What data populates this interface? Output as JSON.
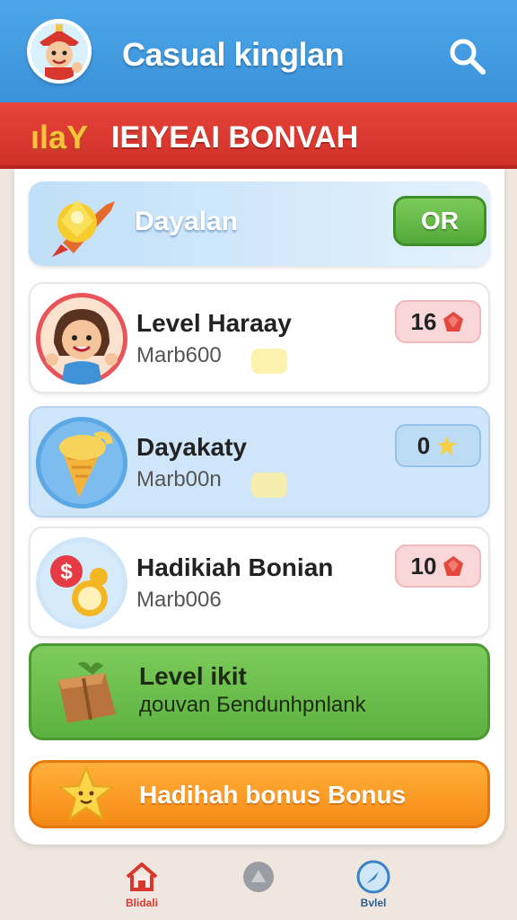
{
  "header": {
    "title": "Casual kinglan",
    "search_icon": "search-icon",
    "avatar_icon": "avatar-icon"
  },
  "banner": {
    "prefix": "ılaY",
    "text": "IEIYEAI BONVAH"
  },
  "hero": {
    "label": "Dayalan",
    "button_label": "OR",
    "icon": "rocket-icon"
  },
  "rows": [
    {
      "title": "Level Haraay",
      "subtitle": "Marb600",
      "badge_value": "16",
      "badge_icon": "gem-icon",
      "thumb_icon": "girl-avatar-icon"
    },
    {
      "title": "Dayakaty",
      "subtitle": "Marb00n",
      "badge_value": "0",
      "badge_icon": "star-icon",
      "thumb_icon": "ice-cream-icon"
    },
    {
      "title": "Hadikiah Bonian",
      "subtitle": "Marb006",
      "badge_value": "10",
      "badge_icon": "gem-icon",
      "thumb_icon": "coins-icon"
    }
  ],
  "green_card": {
    "title": "Level ikit",
    "subtitle": "дouvan Беndunhpnlank",
    "icon": "gift-box-icon"
  },
  "orange_card": {
    "label": "Hadihah bonus Bonus",
    "icon": "star-icon"
  },
  "nav": [
    {
      "label": "Blidali",
      "icon": "home-icon"
    },
    {
      "label": "",
      "icon": "circle-icon"
    },
    {
      "label": "Bvlel",
      "icon": "compass-icon"
    }
  ],
  "colors": {
    "header": "#3a92da",
    "banner": "#cf3028",
    "green": "#5cb23f",
    "orange": "#f58a16"
  }
}
